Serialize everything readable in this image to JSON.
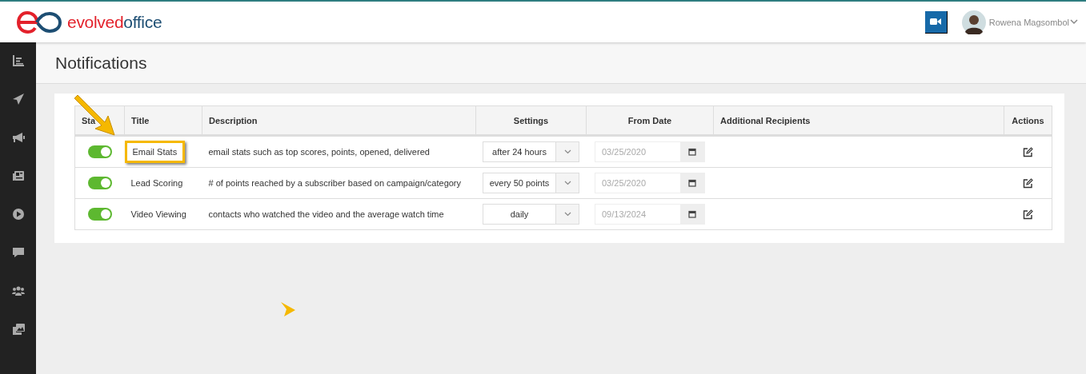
{
  "brand": {
    "part1": "evolved",
    "part2": "office"
  },
  "user": {
    "name": "Rowena Magsombol"
  },
  "sidebar": {
    "items": [
      {
        "kind": "chart"
      },
      {
        "kind": "send"
      },
      {
        "kind": "megaphone"
      },
      {
        "kind": "news"
      },
      {
        "kind": "play"
      },
      {
        "kind": "chat"
      },
      {
        "kind": "users"
      },
      {
        "kind": "media"
      }
    ]
  },
  "page": {
    "title": "Notifications"
  },
  "table": {
    "columns": [
      "Sta",
      "Title",
      "Description",
      "Settings",
      "From Date",
      "Additional Recipients",
      "Actions"
    ],
    "rows": [
      {
        "on": true,
        "title": "Email Stats",
        "highlighted": true,
        "description": "email stats such as top scores, points, opened, delivered",
        "setting": "after 24 hours",
        "from_date": "03/25/2020"
      },
      {
        "on": true,
        "title": "Lead Scoring",
        "highlighted": false,
        "description": "# of points reached by a subscriber based on campaign/category",
        "setting": "every 50 points",
        "from_date": "03/25/2020"
      },
      {
        "on": true,
        "title": "Video Viewing",
        "highlighted": false,
        "description": "contacts who watched the video and the average watch time",
        "setting": "daily",
        "from_date": "09/13/2024"
      }
    ]
  }
}
